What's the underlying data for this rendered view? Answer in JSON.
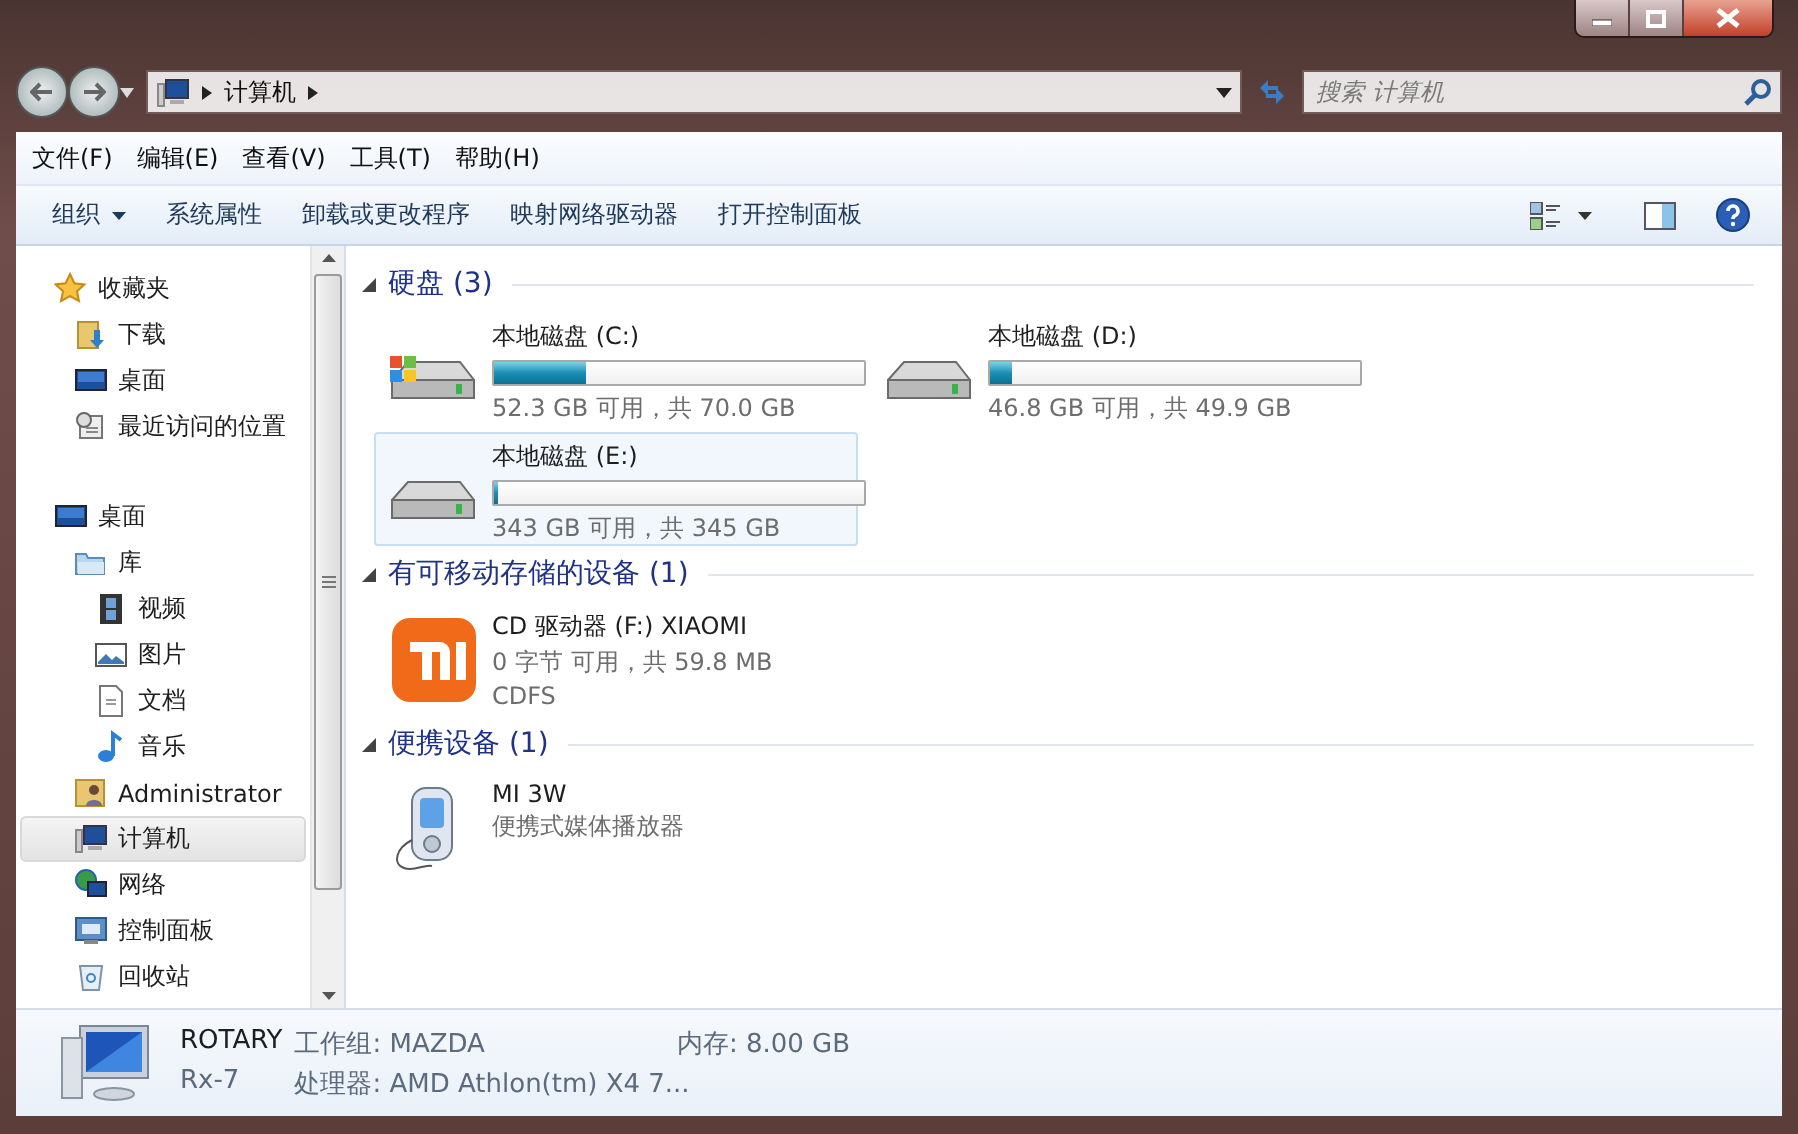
{
  "address": {
    "breadcrumb": [
      "计算机"
    ]
  },
  "search": {
    "placeholder": "搜索 计算机"
  },
  "menu": [
    "文件(F)",
    "编辑(E)",
    "查看(V)",
    "工具(T)",
    "帮助(H)"
  ],
  "commands": [
    {
      "label": "组织",
      "kind": "menu"
    },
    {
      "label": "系统属性",
      "kind": "button"
    },
    {
      "label": "卸载或更改程序",
      "kind": "button"
    },
    {
      "label": "映射网络驱动器",
      "kind": "button"
    },
    {
      "label": "打开控制面板",
      "kind": "button"
    }
  ],
  "nav": [
    {
      "label": "收藏夹",
      "kind": "star",
      "selected": false,
      "children": [
        {
          "label": "下载",
          "kind": "download",
          "selected": false
        },
        {
          "label": "桌面",
          "kind": "desktop",
          "selected": false
        },
        {
          "label": "最近访问的位置",
          "kind": "recent",
          "selected": false
        }
      ]
    },
    {
      "label": "桌面",
      "kind": "desktop",
      "selected": false,
      "children": [
        {
          "label": "库",
          "kind": "library",
          "selected": false,
          "children": [
            {
              "label": "视频",
              "kind": "video",
              "selected": false
            },
            {
              "label": "图片",
              "kind": "picture",
              "selected": false
            },
            {
              "label": "文档",
              "kind": "document",
              "selected": false
            },
            {
              "label": "音乐",
              "kind": "music",
              "selected": false
            }
          ]
        },
        {
          "label": "Administrator",
          "kind": "user",
          "selected": false
        },
        {
          "label": "计算机",
          "kind": "computer",
          "selected": true
        },
        {
          "label": "网络",
          "kind": "network",
          "selected": false
        },
        {
          "label": "控制面板",
          "kind": "control",
          "selected": false
        },
        {
          "label": "回收站",
          "kind": "recycle",
          "selected": false
        }
      ]
    }
  ],
  "sections": [
    {
      "title": "硬盘 (3)",
      "expanded": true,
      "items": [
        {
          "kind": "system-drive",
          "name": "本地磁盘 (C:)",
          "level": 0.25,
          "info": "52.3 GB 可用，共 70.0 GB",
          "selected": false
        },
        {
          "kind": "drive",
          "name": "本地磁盘 (D:)",
          "level": 0.06,
          "info": "46.8 GB 可用，共 49.9 GB",
          "selected": false
        },
        {
          "kind": "drive",
          "name": "本地磁盘 (E:)",
          "level": 0.01,
          "info": "343 GB 可用，共 345 GB",
          "selected": true
        }
      ]
    },
    {
      "title": "有可移动存储的设备 (1)",
      "expanded": true,
      "items": [
        {
          "kind": "cd",
          "name": "CD 驱动器 (F:) XIAOMI",
          "info": "0 字节 可用，共 59.8 MB",
          "extra": "CDFS",
          "selected": false
        }
      ]
    },
    {
      "title": "便携设备 (1)",
      "expanded": true,
      "items": [
        {
          "kind": "phone",
          "name": "MI 3W",
          "info": "便携式媒体播放器",
          "selected": false
        }
      ]
    }
  ],
  "details": {
    "name": "ROTARY",
    "description": "Rx-7",
    "fields": [
      "工作组: MAZDA",
      "内存: 8.00 GB",
      "处理器: AMD Athlon(tm) X4 7..."
    ]
  }
}
